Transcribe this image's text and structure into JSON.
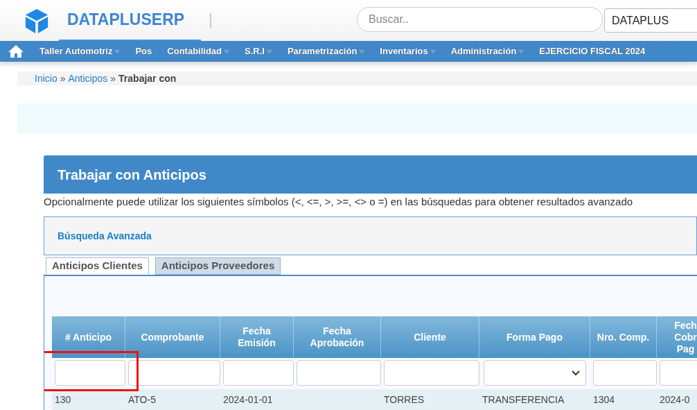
{
  "brand": "DATAPLUSERP",
  "search": {
    "placeholder": "Buscar.."
  },
  "company_select": {
    "value": "DATAPLUS"
  },
  "nav": [
    {
      "label": "Taller Automotriz",
      "dropdown": true
    },
    {
      "label": "Pos",
      "dropdown": false
    },
    {
      "label": "Contabilidad",
      "dropdown": true
    },
    {
      "label": "S.R.I",
      "dropdown": true
    },
    {
      "label": "Parametrización",
      "dropdown": true
    },
    {
      "label": "Inventarios",
      "dropdown": true
    },
    {
      "label": "Administración",
      "dropdown": true
    },
    {
      "label": "EJERCICIO FISCAL 2024",
      "dropdown": false
    }
  ],
  "breadcrumb": [
    {
      "label": "Inicio",
      "kind": "link"
    },
    {
      "label": "»",
      "kind": "separator"
    },
    {
      "label": "Anticipos",
      "kind": "link"
    },
    {
      "label": "»",
      "kind": "separator"
    },
    {
      "label": "Trabajar con",
      "kind": "current"
    }
  ],
  "panel_title": "Trabajar con Anticipos",
  "hint": "Opcionalmente puede utilizar los siguientes símbolos (<, <=, >, >=, <> o =) en las búsquedas para obtener resultados avanzado",
  "advanced_search": "Búsqueda Avanzada",
  "tabs": [
    {
      "label": "Anticipos Clientes",
      "selected": true
    },
    {
      "label": "Anticipos Proveedores",
      "selected": false
    }
  ],
  "table": {
    "columns": [
      {
        "label": "# Anticipo",
        "kind": "text",
        "highlighted": true
      },
      {
        "label": "Comprobante",
        "kind": "text",
        "highlighted": false
      },
      {
        "label": "Fecha Emisión",
        "kind": "text",
        "highlighted": false
      },
      {
        "label": "Fecha Aprobación",
        "kind": "text",
        "highlighted": false
      },
      {
        "label": "Cliente",
        "kind": "text",
        "highlighted": false
      },
      {
        "label": "Forma Pago",
        "kind": "select",
        "highlighted": false
      },
      {
        "label": "Nro. Comp.",
        "kind": "text",
        "highlighted": false
      },
      {
        "label": "Fech Cobr Pag",
        "kind": "text",
        "highlighted": false
      }
    ],
    "rows": [
      [
        "130",
        "ATO-5",
        "2024-01-01",
        "",
        "TORRES",
        "TRANSFERENCIA",
        "1304",
        "2024-0"
      ]
    ]
  }
}
